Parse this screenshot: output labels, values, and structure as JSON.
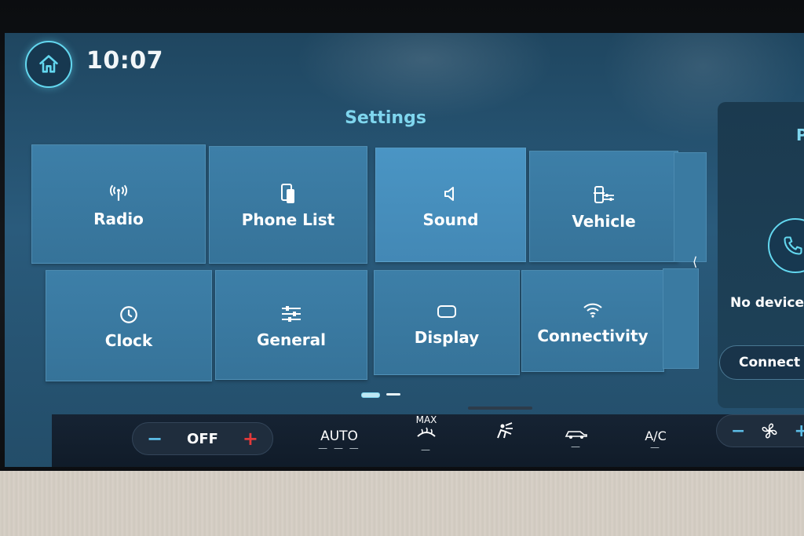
{
  "header": {
    "time": "10:07",
    "home_icon": "home-icon"
  },
  "page": {
    "title": "Settings"
  },
  "tiles": [
    {
      "label": "Radio",
      "icon": "antenna-icon"
    },
    {
      "label": "Phone List",
      "icon": "phone-list-icon"
    },
    {
      "label": "Sound",
      "icon": "speaker-icon"
    },
    {
      "label": "Vehicle",
      "icon": "vehicle-settings-icon"
    },
    {
      "label": "Clock",
      "icon": "clock-icon"
    },
    {
      "label": "General",
      "icon": "sliders-icon"
    },
    {
      "label": "Display",
      "icon": "display-icon"
    },
    {
      "label": "Connectivity",
      "icon": "wifi-icon"
    }
  ],
  "side_panel": {
    "heading_fragment": "P",
    "status": "No device co",
    "connect_button": "Connect Pho",
    "icon": "phone-icon"
  },
  "climate": {
    "temp_status": "OFF",
    "minus": "−",
    "plus": "+",
    "auto_label": "AUTO",
    "max_label": "MAX",
    "ac_label": "A/C",
    "fan_minus": "−",
    "fan_plus": "+"
  },
  "colors": {
    "accent": "#63d7ef",
    "title": "#7fd6ee",
    "tile": "#3a7aa1",
    "plus_red": "#e23a3a"
  }
}
